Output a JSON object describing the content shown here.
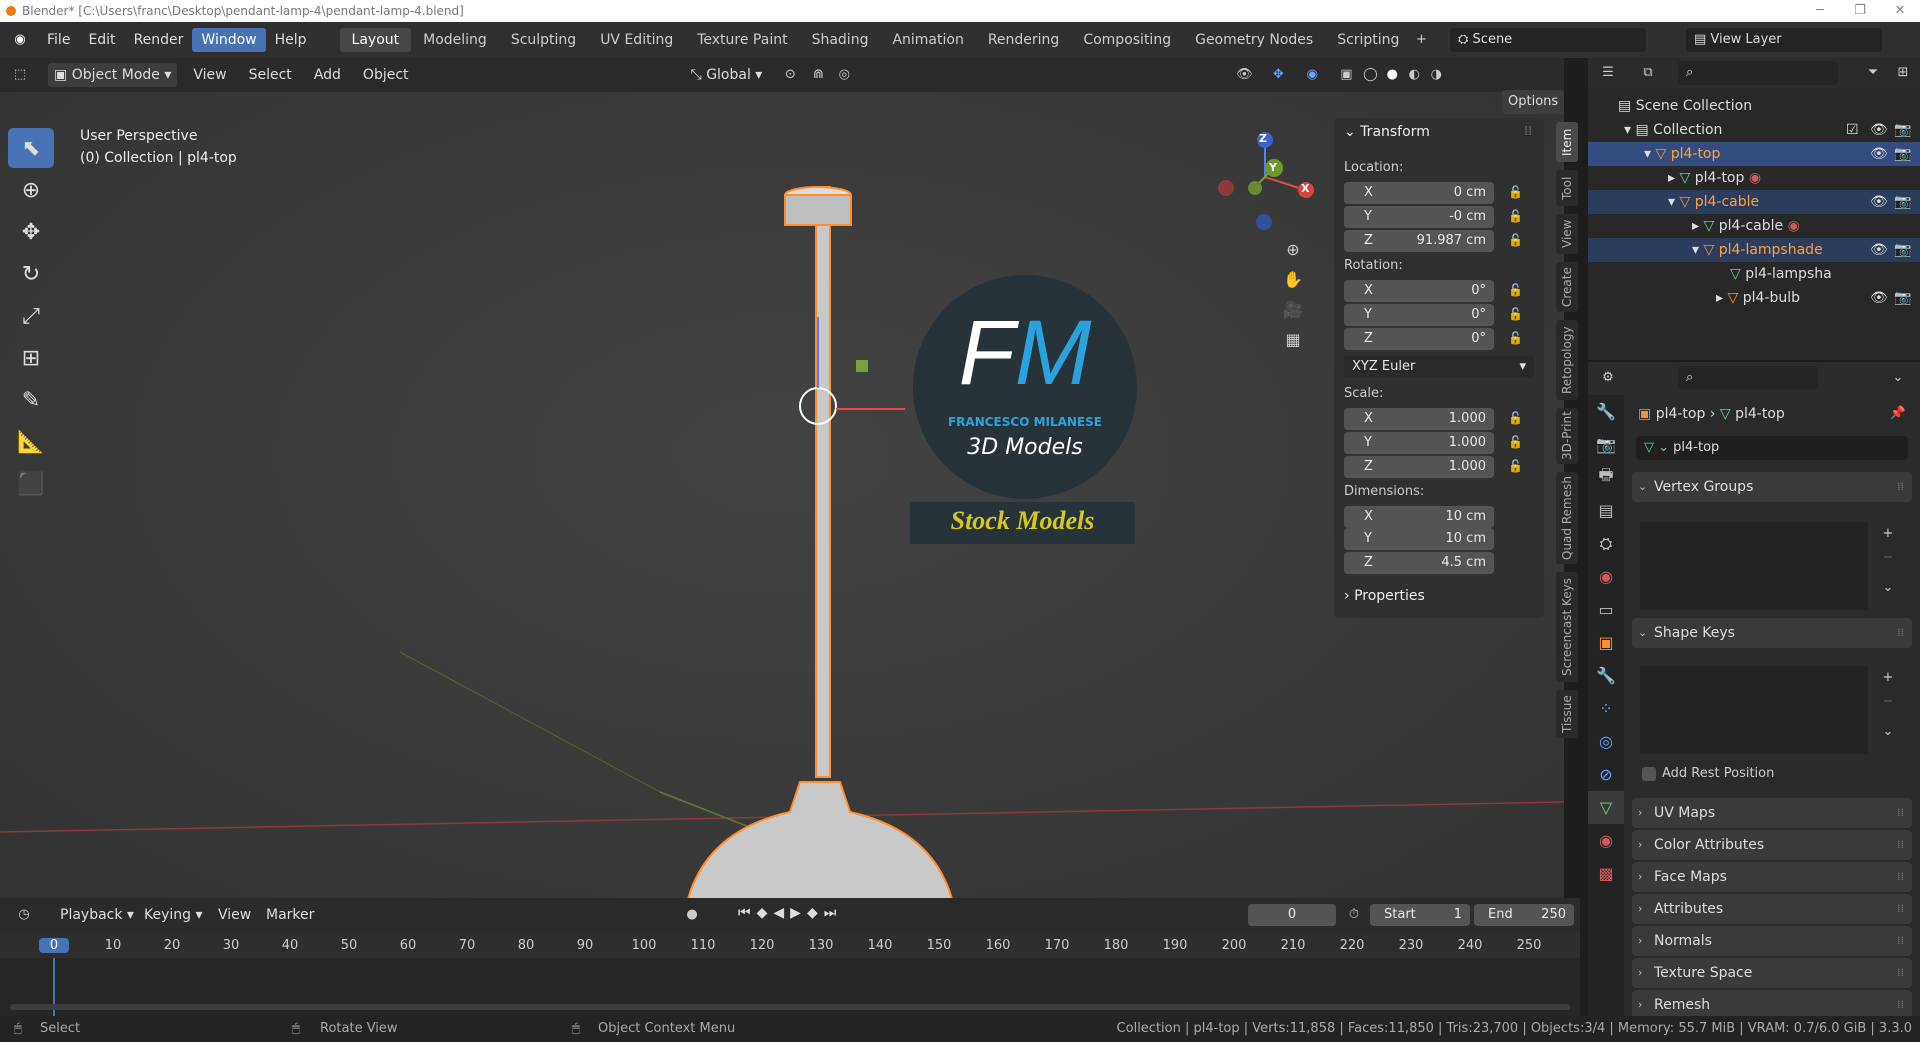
{
  "titlebar": {
    "title": "Blender* [C:\\Users\\franc\\Desktop\\pendant-lamp-4\\pendant-lamp-4.blend]"
  },
  "menu": [
    "File",
    "Edit",
    "Render",
    "Window",
    "Help"
  ],
  "workspaces": [
    "Layout",
    "Modeling",
    "Sculpting",
    "UV Editing",
    "Texture Paint",
    "Shading",
    "Animation",
    "Rendering",
    "Compositing",
    "Geometry Nodes",
    "Scripting"
  ],
  "scene": "Scene",
  "view_layer": "View Layer",
  "viewport_header": {
    "mode": "Object Mode",
    "menus": [
      "View",
      "Select",
      "Add",
      "Object"
    ],
    "orientation": "Global",
    "options": "Options"
  },
  "overlay": {
    "perspective": "User Perspective",
    "collection": "(0) Collection | pl4-top"
  },
  "logo": {
    "initials_f": "F",
    "initials_m": "M",
    "name": "FRANCESCO MILANESE",
    "subtitle": "3D Models",
    "banner": "Stock Models"
  },
  "gizmo": {
    "x": "X",
    "y": "Y",
    "z": "Z"
  },
  "npanel": {
    "title": "Transform",
    "location_label": "Location:",
    "loc": [
      "0 cm",
      "-0 cm",
      "91.987 cm"
    ],
    "rotation_label": "Rotation:",
    "rot": [
      "0°",
      "0°",
      "0°"
    ],
    "rot_mode": "XYZ Euler",
    "scale_label": "Scale:",
    "scale": [
      "1.000",
      "1.000",
      "1.000"
    ],
    "dimensions_label": "Dimensions:",
    "dim": [
      "10 cm",
      "10 cm",
      "4.5 cm"
    ],
    "properties": "Properties",
    "axes": [
      "X",
      "Y",
      "Z"
    ]
  },
  "vtabs": [
    "Item",
    "Tool",
    "View",
    "Create",
    "Retopology",
    "3D-Print",
    "Quad Remesh",
    "Screencast Keys",
    "Tissue"
  ],
  "outliner": {
    "scene_collection": "Scene Collection",
    "collection": "Collection",
    "items": [
      {
        "name": "pl4-top",
        "kind": "object",
        "selected": true
      },
      {
        "name": "pl4-top",
        "kind": "mesh"
      },
      {
        "name": "pl4-cable",
        "kind": "object",
        "selected": true
      },
      {
        "name": "pl4-cable",
        "kind": "mesh"
      },
      {
        "name": "pl4-lampshade",
        "kind": "object",
        "selected": true
      },
      {
        "name": "pl4-lampsha",
        "kind": "mesh"
      },
      {
        "name": "pl4-bulb",
        "kind": "object"
      }
    ]
  },
  "properties": {
    "breadcrumb_object": "pl4-top",
    "breadcrumb_mesh": "pl4-top",
    "mesh_name": "pl4-top",
    "sections": [
      "Vertex Groups",
      "Shape Keys"
    ],
    "add_rest": "Add Rest Position",
    "collapsed": [
      "UV Maps",
      "Color Attributes",
      "Face Maps",
      "Attributes",
      "Normals",
      "Texture Space",
      "Remesh"
    ]
  },
  "timeline": {
    "menus": [
      "Playback",
      "Keying",
      "View",
      "Marker"
    ],
    "current": "0",
    "start_label": "Start",
    "start": "1",
    "end_label": "End",
    "end": "250",
    "frames": [
      "0",
      "10",
      "20",
      "30",
      "40",
      "50",
      "60",
      "70",
      "80",
      "90",
      "100",
      "110",
      "120",
      "130",
      "140",
      "150",
      "160",
      "170",
      "180",
      "190",
      "200",
      "210",
      "220",
      "230",
      "240",
      "250"
    ]
  },
  "status": {
    "select": "Select",
    "rotate": "Rotate View",
    "context": "Object Context Menu",
    "stats": "Collection | pl4-top | Verts:11,858 | Faces:11,850 | Tris:23,700 | Objects:3/4 | Memory: 55.7 MiB | VRAM: 0.7/6.0 GiB | 3.3.0"
  }
}
